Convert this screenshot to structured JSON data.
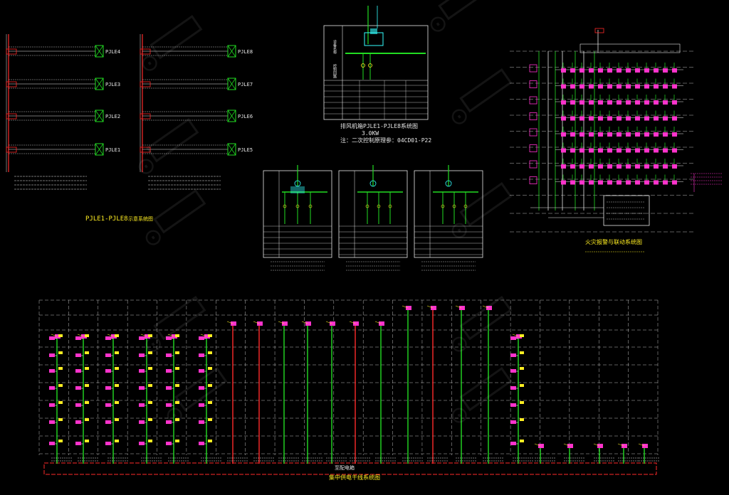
{
  "colors": {
    "background": "#000000",
    "wire_red": "#ff2a2a",
    "wire_green": "#22dd22",
    "wire_white": "#e8e8e8",
    "device_magenta": "#ff33cc",
    "label_cyan": "#33ffff",
    "label_yellow": "#ffee22",
    "grid_dash": "#bbbbbb"
  },
  "panel_upper_left": {
    "left_boxes": [
      "PJLE4",
      "PJLE3",
      "PJLE2",
      "PJLE1"
    ],
    "right_boxes": [
      "PJLE8",
      "PJLE7",
      "PJLE6",
      "PJLE5"
    ],
    "caption_code": "PJLE1-PJLE8",
    "caption_suffix": "示意系统图"
  },
  "panel_top_center": {
    "caption_line1": "排风机箱PJLE1-PJLE8系统图",
    "caption_line2": "3.0KW",
    "caption_line3": "注：二次控制原理参：04CD01-P22"
  },
  "panel_right": {
    "caption": "火灾报警与联动系统图"
  },
  "panel_bottom": {
    "caption_top": "至配电箱",
    "caption_main": "集中供电干线系统图"
  },
  "icons": {
    "watermark": "watermark-logo-icon",
    "device": "distribution-box-icon"
  }
}
